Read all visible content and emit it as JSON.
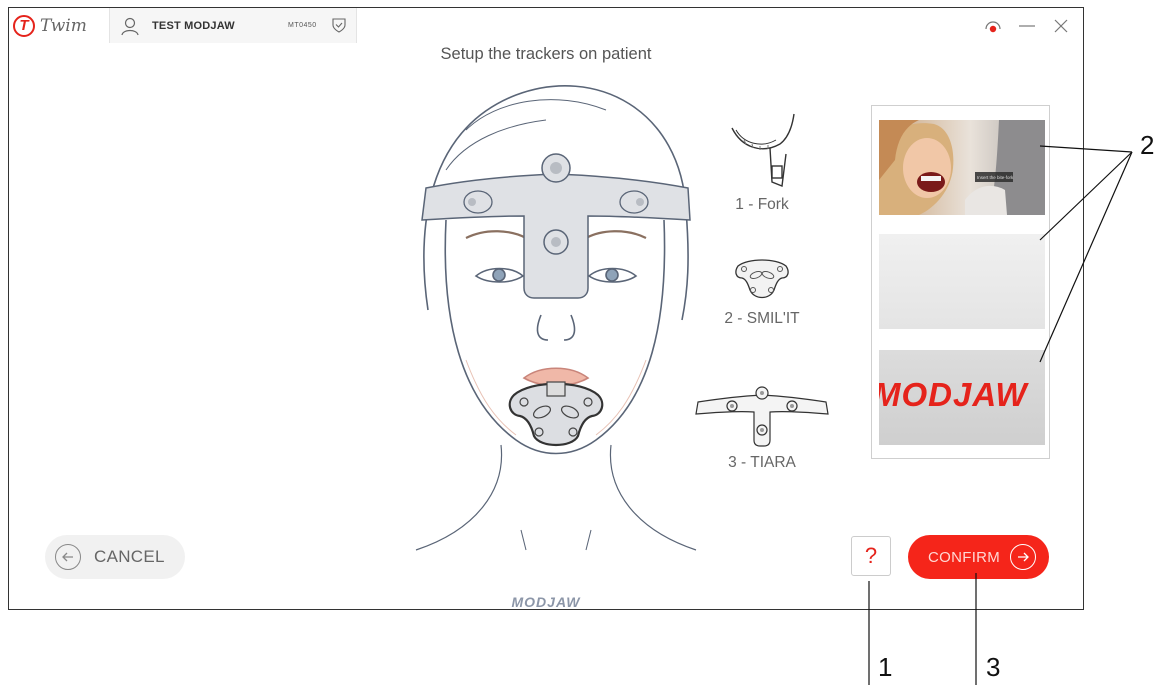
{
  "app": {
    "logo_letter": "T",
    "name": "Twim"
  },
  "patient": {
    "name": "TEST MODJAW",
    "code": "MT0450"
  },
  "heading": "Setup the trackers on patient",
  "trackers": [
    {
      "label": "1 - Fork",
      "icon": "fork-tracker-icon"
    },
    {
      "label": "2 - SMIL'IT",
      "icon": "smilit-tracker-icon"
    },
    {
      "label": "3 - TIARA",
      "icon": "tiara-tracker-icon"
    }
  ],
  "videos": {
    "thumb_1_caption": "Insert the bite-fork",
    "thumb_3_brand": "MODJAW"
  },
  "buttons": {
    "cancel": "CANCEL",
    "help": "?",
    "confirm": "CONFIRM"
  },
  "footer_brand": "MODJAW",
  "callouts": {
    "c1": "1",
    "c2": "2",
    "c3": "3"
  },
  "colors": {
    "accent": "#f5251a",
    "brand_red": "#e5231b",
    "line": "#5a6577"
  }
}
